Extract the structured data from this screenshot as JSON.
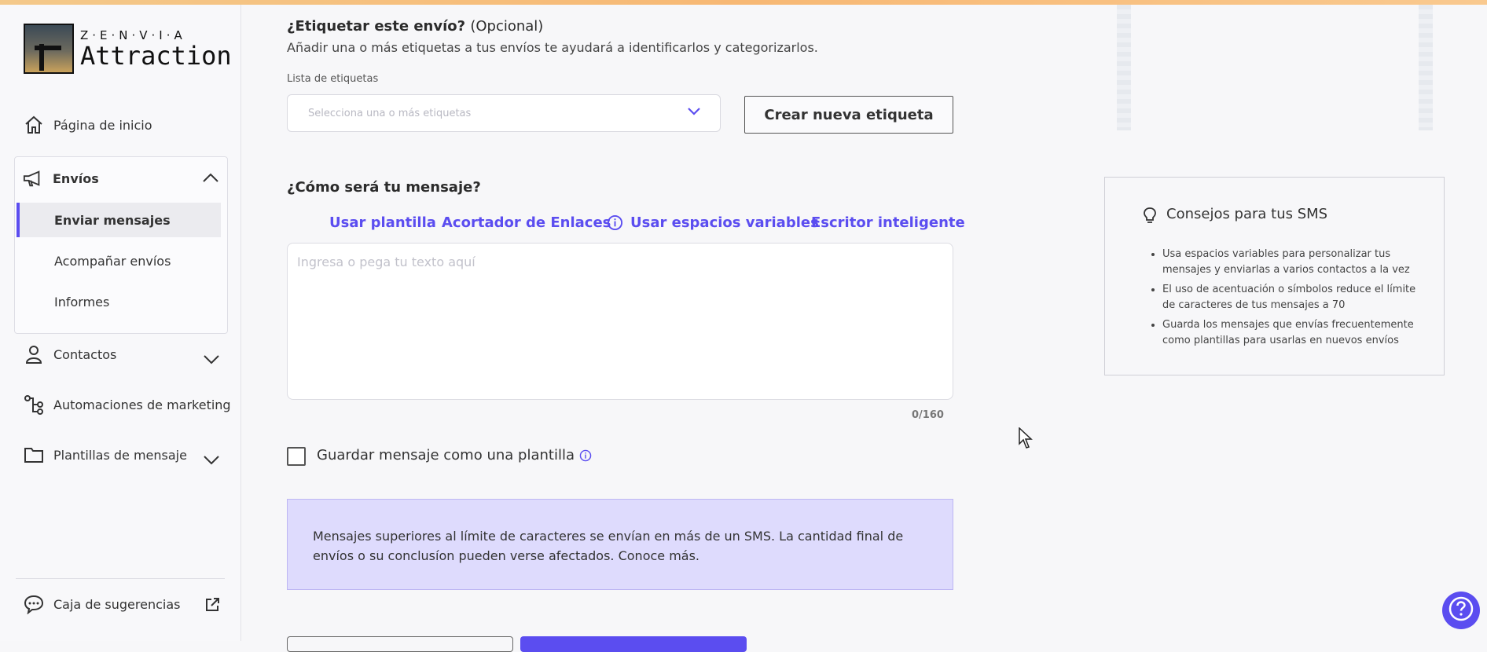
{
  "brand": {
    "top": "Z·E·N·V·I·A",
    "name": "Attraction"
  },
  "sidebar": {
    "home": "Página de inicio",
    "envios": "Envíos",
    "envios_sub": [
      "Enviar mensajes",
      "Acompañar envíos",
      "Informes"
    ],
    "contacts": "Contactos",
    "automations": "Automaciones de marketing",
    "templates": "Plantillas de mensaje",
    "suggestions": "Caja de sugerencias"
  },
  "tag_section": {
    "title": "¿Etiquetar este envío?",
    "optional": "(Opcional)",
    "description": "Añadir una o más etiquetas a tus envíos te ayudará a identificarlos y categorizarlos.",
    "list_label": "Lista de etiquetas",
    "select_placeholder": "Selecciona una o más etiquetas",
    "create_button": "Crear nueva etiqueta"
  },
  "message_section": {
    "title": "¿Cómo será tu mensaje?",
    "links": [
      "Usar plantilla",
      "Acortador de Enlaces",
      "Usar espacios variables",
      "Escritor inteligente"
    ],
    "placeholder": "Ingresa o pega tu texto aquí",
    "counter": "0/160",
    "save_template_label": "Guardar mensaje como una plantilla",
    "info_text": "Mensajes superiores al límite de caracteres se envían en más de un SMS. La cantidad final de envíos o su conclusíon pueden verse afectados. Conoce más."
  },
  "tips": {
    "title": "Consejos para tus SMS",
    "items": [
      "Usa espacios variables para personalizar tus mensajes y enviarlas a varios contactos a la vez",
      "El uso de acentuación o símbolos reduce el límite de caracteres de tus mensajes a 70",
      "Guarda los mensajes que envías frecuentemente como plantillas para usarlas en nuevos envíos"
    ]
  },
  "colors": {
    "accent": "#5b4df0",
    "info_bg": "#dedbfd"
  }
}
